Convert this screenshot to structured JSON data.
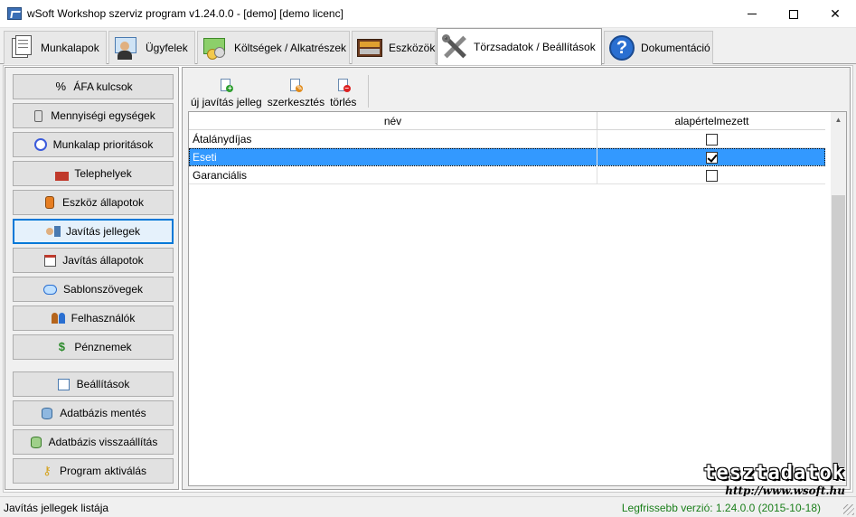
{
  "window": {
    "title": "wSoft Workshop szerviz program v1.24.0.0 - [demo] [demo licenc]",
    "minimize_icon": "minimize-icon",
    "maximize_icon": "maximize-icon",
    "close_icon": "close-icon"
  },
  "tabs": [
    {
      "label": "Munkalapok",
      "icon": "worksheets-icon"
    },
    {
      "label": "Ügyfelek",
      "icon": "customers-icon"
    },
    {
      "label": "Költségek / Alkatrészek",
      "icon": "costs-icon"
    },
    {
      "label": "Eszközök",
      "icon": "devices-icon"
    },
    {
      "label": "Törzsadatok / Beállítások",
      "icon": "tools-icon",
      "active": true
    },
    {
      "label": "Dokumentáció",
      "icon": "help-icon"
    }
  ],
  "sidebar": {
    "items": [
      {
        "label": "ÁFA kulcsok",
        "icon": "percent-icon"
      },
      {
        "label": "Mennyiségi egységek",
        "icon": "unit-icon"
      },
      {
        "label": "Munkalap prioritások",
        "icon": "clock-icon"
      },
      {
        "label": "Telephelyek",
        "icon": "factory-icon"
      },
      {
        "label": "Eszköz állapotok",
        "icon": "device-status-icon"
      },
      {
        "label": "Javítás jellegek",
        "icon": "repair-type-icon",
        "selected": true
      },
      {
        "label": "Javítás állapotok",
        "icon": "calendar-icon"
      },
      {
        "label": "Sablonszövegek",
        "icon": "speech-bubble-icon"
      },
      {
        "label": "Felhasználók",
        "icon": "users-icon"
      },
      {
        "label": "Pénznemek",
        "icon": "currency-icon"
      }
    ],
    "bottom_items": [
      {
        "label": "Beállítások",
        "icon": "settings-icon"
      },
      {
        "label": "Adatbázis mentés",
        "icon": "database-backup-icon"
      },
      {
        "label": "Adatbázis visszaállítás",
        "icon": "database-restore-icon"
      },
      {
        "label": "Program aktiválás",
        "icon": "key-icon"
      }
    ]
  },
  "toolbar": {
    "new_label": "új javítás jelleg",
    "edit_label": "szerkesztés",
    "delete_label": "törlés"
  },
  "grid": {
    "columns": [
      "név",
      "alapértelmezett"
    ],
    "rows": [
      {
        "name": "Átalánydíjas",
        "default": false
      },
      {
        "name": "Eseti",
        "default": true,
        "selected": true
      },
      {
        "name": "Garanciális",
        "default": false
      }
    ]
  },
  "status": {
    "left": "Javítás jellegek listája",
    "right": "Legfrissebb verzió: 1.24.0.0 (2015-10-18)"
  },
  "watermark": {
    "line1": "tesztadatok",
    "line2": "http://www.wsoft.hu"
  },
  "colors": {
    "selection": "#3399ff",
    "accent": "#0078d7",
    "version_text": "#1a7f1a"
  }
}
